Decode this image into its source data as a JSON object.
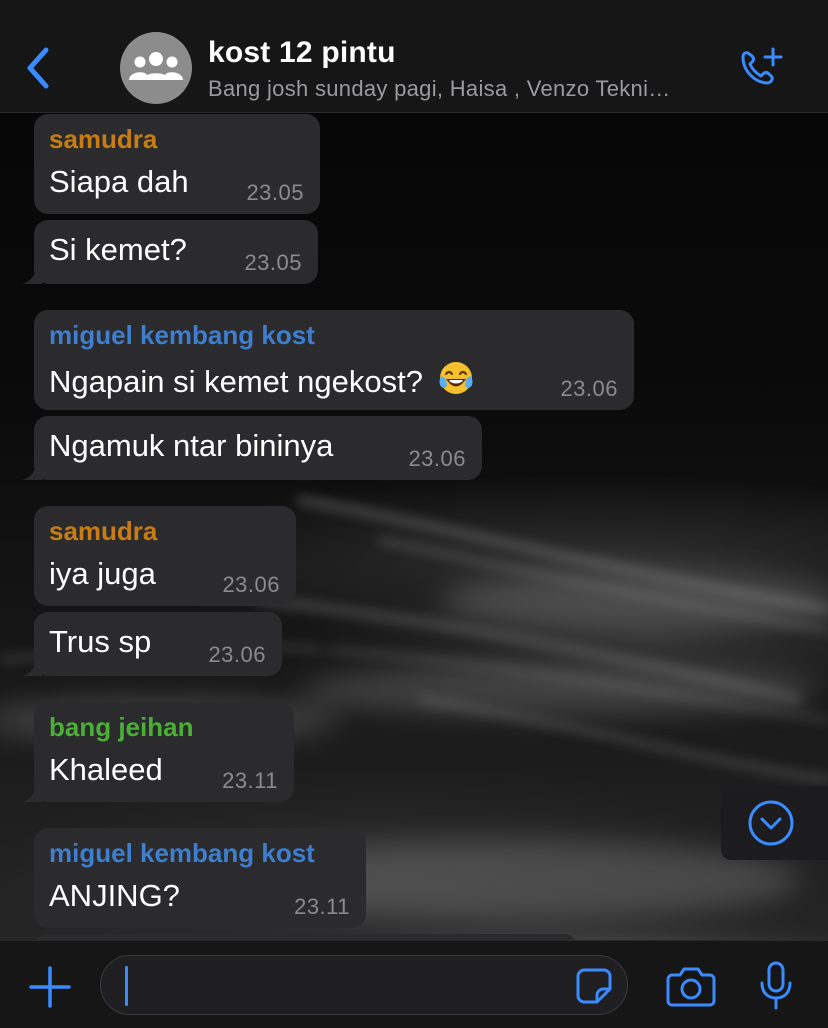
{
  "colors": {
    "accent": "#3a8bff",
    "bubble": "#2b2b2d",
    "sender_samudra": "#c87d14",
    "sender_miguel": "#3e7ecf",
    "sender_jeihan": "#4aae37"
  },
  "header": {
    "title": "kost 12 pintu",
    "subtitle": "Bang josh sunday pagi, Haisa , Venzo Tekni…",
    "back_icon": "chevron-left-icon",
    "avatar_icon": "group-icon",
    "call_icon": "add-call-icon"
  },
  "messages": [
    {
      "sender": "samudra",
      "text": "Siapa dah",
      "time": "23.05"
    },
    {
      "sender": "",
      "text": "Si kemet?",
      "time": "23.05"
    },
    {
      "sender": "miguel kembang kost",
      "text": "Ngapain si kemet ngekost?",
      "emoji": "😂",
      "time": "23.06"
    },
    {
      "sender": "",
      "text": "Ngamuk ntar bininya",
      "time": "23.06"
    },
    {
      "sender": "samudra",
      "text": "iya juga",
      "time": "23.06"
    },
    {
      "sender": "",
      "text": "Trus sp",
      "time": "23.06"
    },
    {
      "sender": "bang jeihan",
      "text": "Khaleed",
      "time": "23.11"
    },
    {
      "sender": "miguel kembang kost",
      "text": "ANJING?",
      "time": "23.11"
    }
  ],
  "composer": {
    "value": "",
    "plus_icon": "plus-icon",
    "sticker_icon": "sticker-icon",
    "camera_icon": "camera-icon",
    "mic_icon": "microphone-icon"
  },
  "scroll_icon": "chevron-down-circle-icon"
}
